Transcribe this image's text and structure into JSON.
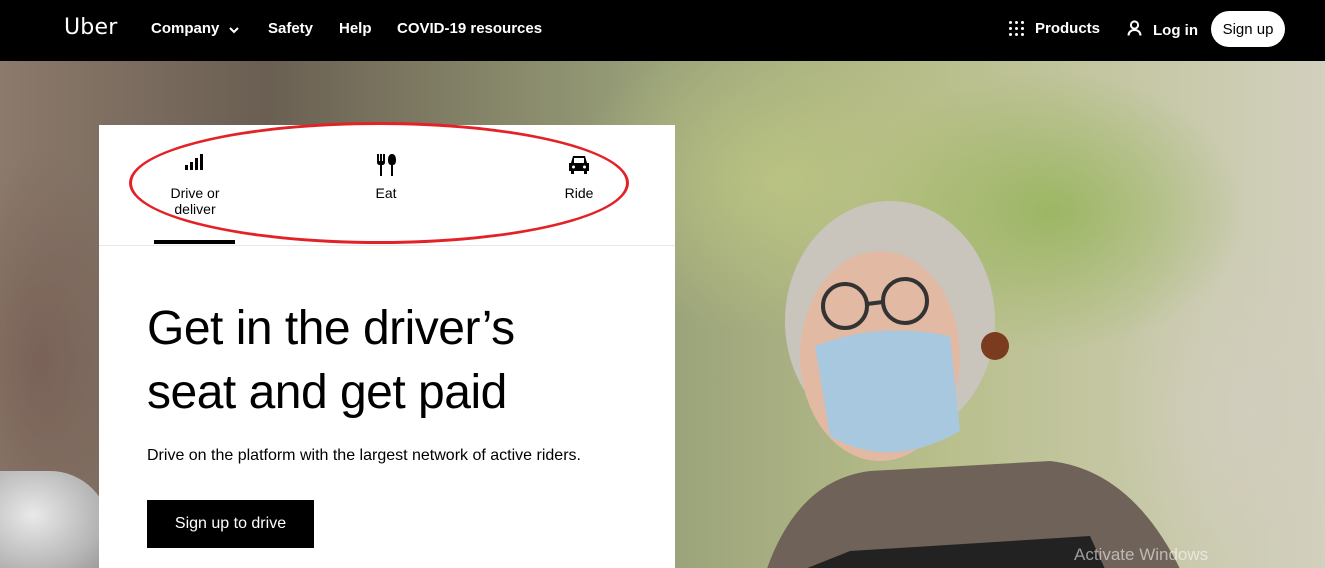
{
  "nav": {
    "logo": "Uber",
    "links": [
      "Company",
      "Safety",
      "Help",
      "COVID-19 resources"
    ],
    "products": "Products",
    "login": "Log in",
    "signup": "Sign up"
  },
  "tabs": [
    {
      "label": "Drive or deliver",
      "icon": "signal-bars-icon"
    },
    {
      "label": "Eat",
      "icon": "fork-knife-icon"
    },
    {
      "label": "Ride",
      "icon": "car-icon"
    }
  ],
  "hero": {
    "headline": "Get in the driver’s seat and get paid",
    "subtext": "Drive on the platform with the largest network of active riders.",
    "cta": "Sign up to drive"
  },
  "watermark": "Activate Windows",
  "colors": {
    "annotation_oval": "#e32227",
    "nav_bg": "#000000"
  }
}
